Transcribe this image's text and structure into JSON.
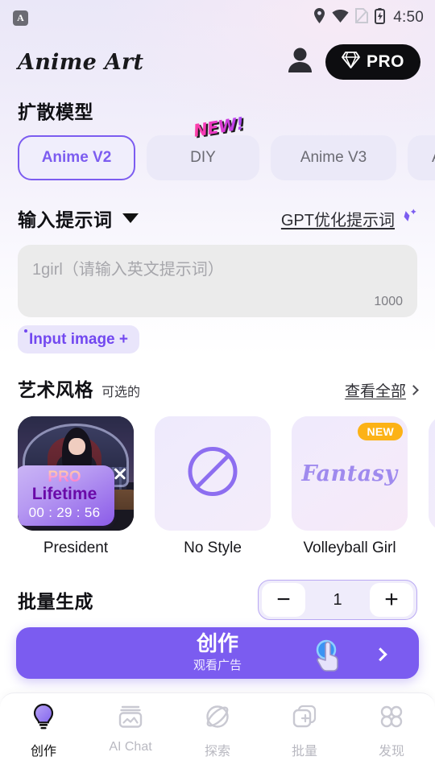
{
  "status_bar": {
    "app_badge": "A",
    "time": "4:50",
    "icons": [
      "location-icon",
      "wifi-icon",
      "sim-card-icon",
      "battery-charging-icon"
    ]
  },
  "header": {
    "brand": "Anime Art",
    "account_icon": "person-icon",
    "pro_label": "PRO",
    "pro_icon": "diamond-icon"
  },
  "model_section": {
    "title": "扩散模型",
    "tabs": [
      {
        "label": "Anime V2",
        "selected": true
      },
      {
        "label": "DIY",
        "selected": false,
        "badge": "NEW!"
      },
      {
        "label": "Anime V3",
        "selected": false
      },
      {
        "label": "A",
        "selected": false
      }
    ]
  },
  "prompt_section": {
    "title": "输入提示词",
    "dropdown_icon": "chevron-down-icon",
    "gpt_link": "GPT优化提示词",
    "gpt_icon": "sparkle-icon",
    "placeholder": "1girl（请输入英文提示词）",
    "char_limit": "1000",
    "input_image_label": "Input image +"
  },
  "style_section": {
    "title": "艺术风格",
    "subtitle": "可选的",
    "see_all": "查看全部",
    "see_all_icon": "chevron-right-icon",
    "cards": [
      {
        "label": "President",
        "kind": "photo",
        "close_icon": "close-icon",
        "promo": {
          "tier": "PRO",
          "plan": "Lifetime",
          "countdown": "00 : 29 : 56"
        }
      },
      {
        "label": "No Style",
        "kind": "none",
        "icon": "no-style-icon"
      },
      {
        "label": "Volleyball Girl",
        "kind": "fantasy",
        "art_text": "Fantasy",
        "badge": "NEW"
      },
      {
        "label": "",
        "kind": "plain"
      }
    ]
  },
  "batch_section": {
    "title": "批量生成",
    "decrement": "−",
    "value": "1",
    "increment": "+"
  },
  "create_button": {
    "main": "创作",
    "sub": "观看广告",
    "chevron_icon": "chevron-right-icon",
    "cursor_icon": "tap-cursor-icon"
  },
  "bottom_nav": [
    {
      "label": "创作",
      "icon": "lightbulb-icon",
      "active": true
    },
    {
      "label": "AI Chat",
      "icon": "image-icon",
      "active": false
    },
    {
      "label": "探索",
      "icon": "planet-icon",
      "active": false
    },
    {
      "label": "批量",
      "icon": "stack-add-icon",
      "active": false
    },
    {
      "label": "发现",
      "icon": "clover-icon",
      "active": false
    }
  ],
  "colors": {
    "accent": "#7b5cf0",
    "accent_soft": "#ebe9f8",
    "badge_new": "#fcb216",
    "pro_black": "#0d0d10"
  }
}
